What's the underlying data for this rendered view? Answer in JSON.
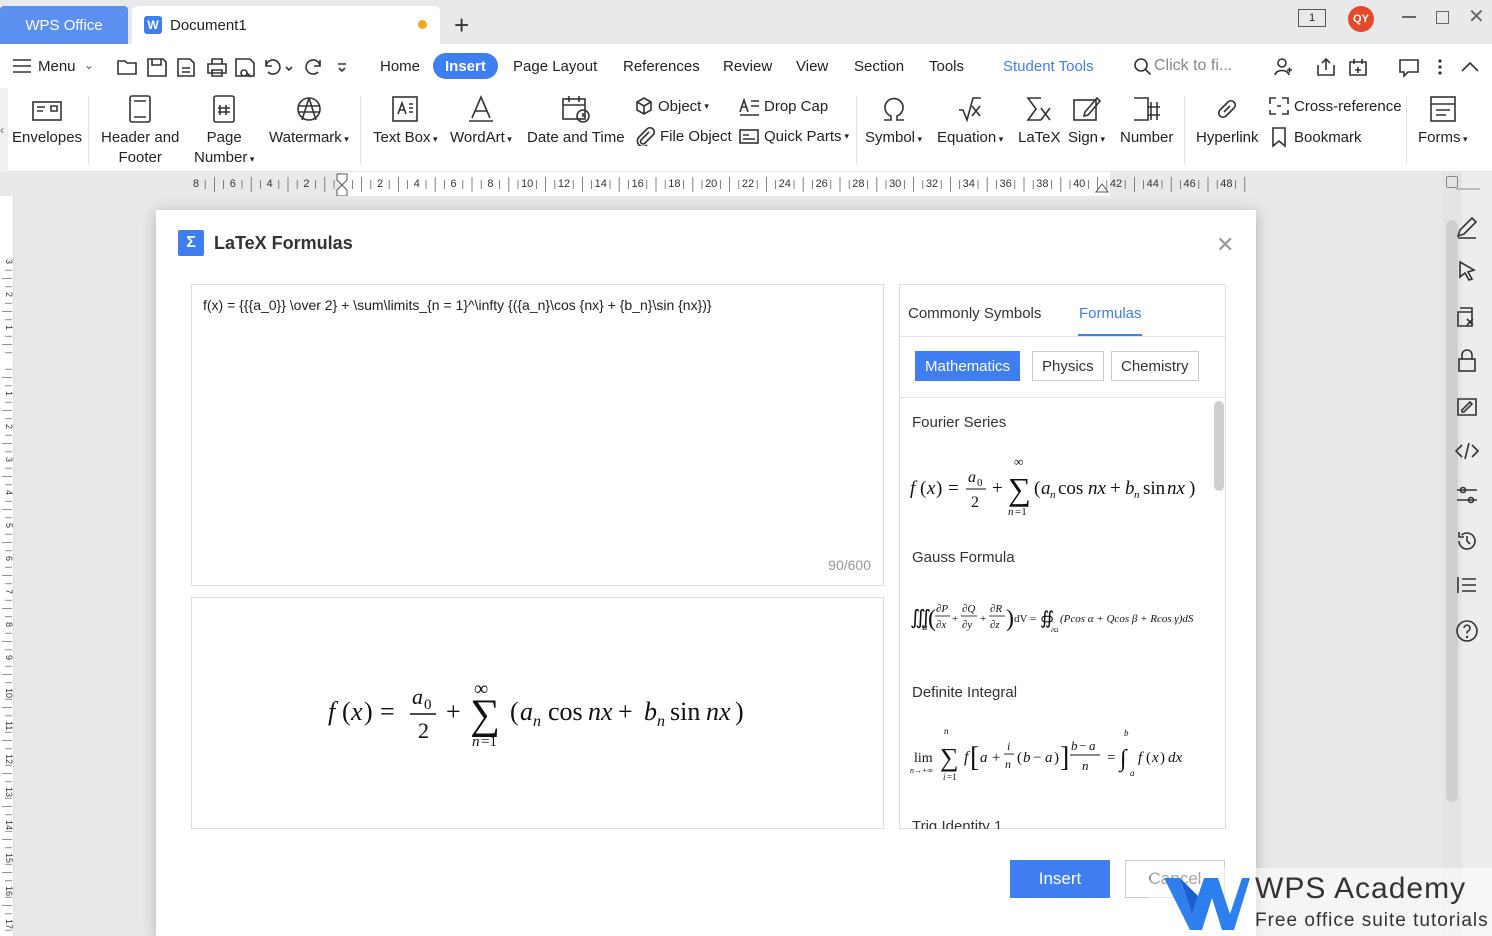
{
  "titlebar": {
    "app_tab": "WPS Office",
    "doc_tab": "Document1",
    "avatar": "QY",
    "page_badge": "1"
  },
  "menubar": {
    "menu_label": "Menu",
    "tabs": [
      "Home",
      "Insert",
      "Page Layout",
      "References",
      "Review",
      "View",
      "Section",
      "Tools",
      "Student Tools"
    ],
    "active_tab": "Insert",
    "search_placeholder": "Click to fi..."
  },
  "ribbon": {
    "envelopes": "Envelopes",
    "header_footer": [
      "Header and",
      "Footer"
    ],
    "page_number": [
      "Page",
      "Number"
    ],
    "watermark": "Watermark",
    "text_box": "Text Box",
    "wordart": "WordArt",
    "date_time": "Date and Time",
    "object": "Object",
    "file_object": "File Object",
    "drop_cap": "Drop Cap",
    "quick_parts": "Quick Parts",
    "symbol": "Symbol",
    "equation": "Equation",
    "latex": "LaTeX",
    "sign": "Sign",
    "number": "Number",
    "hyperlink": "Hyperlink",
    "cross_reference": "Cross-reference",
    "bookmark": "Bookmark",
    "forms": "Forms"
  },
  "ruler": {
    "ticks": [
      "8",
      "6",
      "4",
      "2",
      "",
      "2",
      "4",
      "6",
      "8",
      "10",
      "12",
      "14",
      "16",
      "18",
      "20",
      "22",
      "24",
      "26",
      "28",
      "30",
      "32",
      "34",
      "36",
      "38",
      "40",
      "42",
      "44",
      "46",
      "48"
    ]
  },
  "vruler": {
    "ticks": [
      "3",
      "2",
      "1",
      "",
      "1",
      "2",
      "3",
      "4",
      "5",
      "6",
      "7",
      "8",
      "9",
      "10",
      "11",
      "12",
      "13",
      "14",
      "15",
      "16",
      "17"
    ]
  },
  "dialog": {
    "title": "LaTeX Formulas",
    "latex_input": "f(x) = {{{a_0}} \\over 2} + \\sum\\limits_{n = 1}^\\infty  {({a_n}\\cos {nx} + {b_n}\\sin {nx})}",
    "char_count": "90/600",
    "panel_tabs": [
      "Commonly Symbols",
      "Formulas"
    ],
    "selected_panel_tab": "Formulas",
    "categories": [
      "Mathematics",
      "Physics",
      "Chemistry"
    ],
    "selected_category": "Mathematics",
    "formulas": [
      "Fourier Series",
      "Gauss Formula",
      "Definite Integral",
      "Trig Identity 1"
    ],
    "insert_label": "Insert",
    "cancel_label": "Cancel"
  },
  "watermark": {
    "brand": "WPS Academy",
    "tagline": "Free office suite tutorials"
  },
  "colors": {
    "accent": "#3f7ef0",
    "app_tab": "#5b8ff0",
    "unsaved_dot": "#f5a623",
    "avatar": "#e24a2a"
  }
}
